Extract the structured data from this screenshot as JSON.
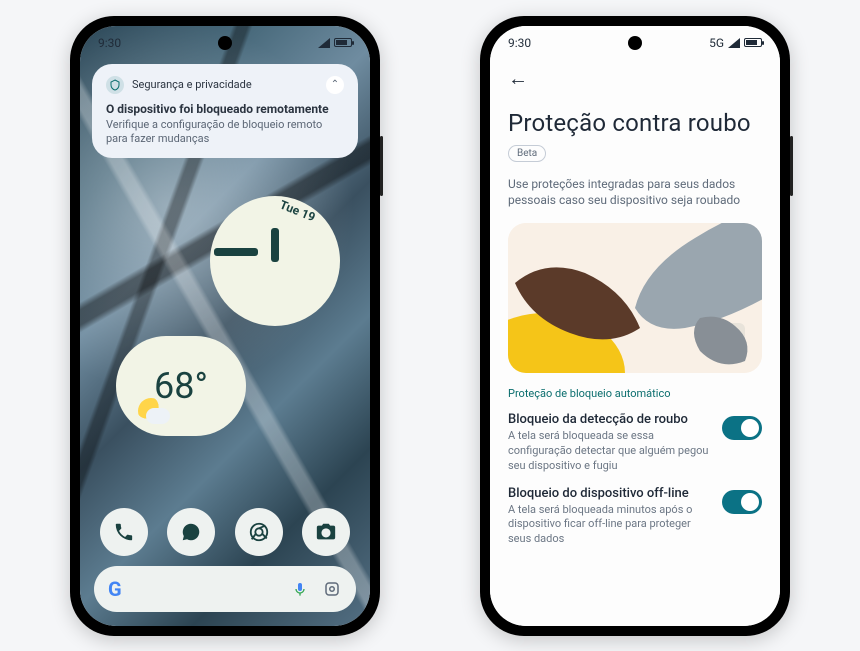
{
  "status_time": "9:30",
  "status_net": "5G",
  "phone1": {
    "notification": {
      "category": "Segurança e privacidade",
      "title": "O dispositivo foi bloqueado remotamente",
      "body": "Verifique a configuração de bloqueio remoto para fazer mudanças"
    },
    "clock_date": "Tue 19",
    "weather_temp": "68°",
    "search_letter": "G"
  },
  "phone2": {
    "title": "Proteção contra roubo",
    "beta": "Beta",
    "subtitle": "Use proteções integradas para seus dados pessoais caso seu dispositivo seja roubado",
    "section": "Proteção de bloqueio automático",
    "row1": {
      "title": "Bloqueio da detecção de roubo",
      "desc": "A tela será bloqueada se essa configuração detectar que alguém pegou seu dispositivo e fugiu"
    },
    "row2": {
      "title": "Bloqueio do dispositivo off-line",
      "desc": "A tela será bloqueada minutos após o dispositivo ficar off-line para proteger seus dados"
    }
  }
}
